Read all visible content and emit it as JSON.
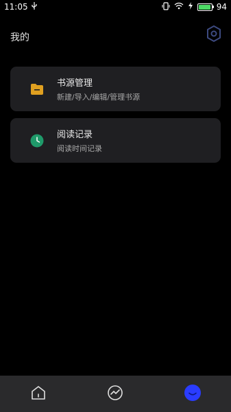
{
  "status_bar": {
    "time": "11:05",
    "battery": "94"
  },
  "header": {
    "title": "我的"
  },
  "cards": [
    {
      "title": "书源管理",
      "subtitle": "新建/导入/编辑/管理书源",
      "icon": "folder-icon",
      "color": "#e0a020"
    },
    {
      "title": "阅读记录",
      "subtitle": "阅读时间记录",
      "icon": "clock-icon",
      "color": "#1f9a6a"
    }
  ],
  "bottom_nav": {
    "items": [
      "home-icon",
      "trend-icon",
      "profile-icon"
    ],
    "active_color": "#2a3cff"
  },
  "colors": {
    "background": "#000000",
    "card": "#1f1f22",
    "nav": "#2a2a2c",
    "settings_icon": "#3d4a80"
  }
}
